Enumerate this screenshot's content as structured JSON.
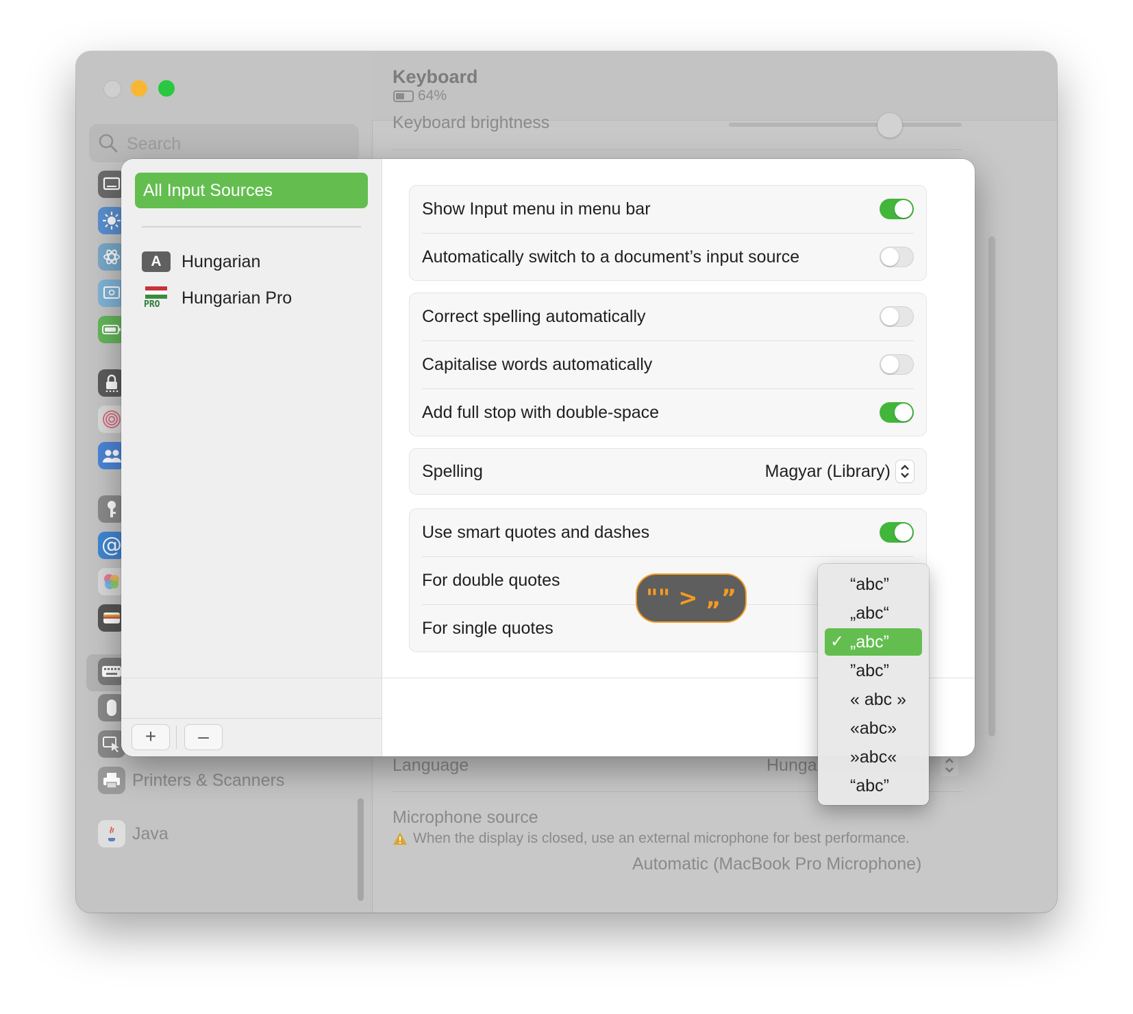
{
  "window": {
    "title": "Keyboard",
    "battery_label": "64%"
  },
  "sidebar": {
    "search_placeholder": "Search",
    "items": [
      {
        "label": "Printers & Scanners"
      },
      {
        "label": "Java"
      }
    ]
  },
  "background_settings": {
    "keyboard_brightness_label": "Keyboard brightness",
    "language_label": "Language",
    "language_value": "Hunga",
    "microphone_label": "Microphone source",
    "microphone_warning": "When the display is closed, use an external microphone for best performance.",
    "microphone_value": "Automatic (MacBook Pro Microphone)"
  },
  "input_sources": {
    "all_label": "All Input Sources",
    "items": [
      {
        "label": "Hungarian",
        "icon_text": "A"
      },
      {
        "label": "Hungarian Pro",
        "icon_text": "PRO"
      }
    ],
    "add_label": "+",
    "remove_label": "–"
  },
  "options": {
    "group1": [
      {
        "label": "Show Input menu in menu bar",
        "on": true
      },
      {
        "label": "Automatically switch to a document’s input source",
        "on": false
      }
    ],
    "group2": [
      {
        "label": "Correct spelling automatically",
        "on": false
      },
      {
        "label": "Capitalise words automatically",
        "on": false
      },
      {
        "label": "Add full stop with double-space",
        "on": true
      }
    ],
    "spelling": {
      "label": "Spelling",
      "value": "Magyar (Library)"
    },
    "smart_quotes": {
      "label": "Use smart quotes and dashes",
      "on": true
    },
    "double_quotes_label": "For double quotes",
    "single_quotes_label": "For single quotes"
  },
  "annotation": {
    "text": "\"\" > „”"
  },
  "quote_menu": {
    "items": [
      "“abc”",
      "„abc“",
      "„abc”",
      "”abc”",
      "« abc »",
      "«abc»",
      "»abc«",
      "“abc”"
    ],
    "selected_index": 2,
    "check_glyph": "✓"
  },
  "colors": {
    "accent_green": "#63be4f",
    "toggle_on": "#41b63a",
    "annotation_orange": "#f59b22"
  }
}
